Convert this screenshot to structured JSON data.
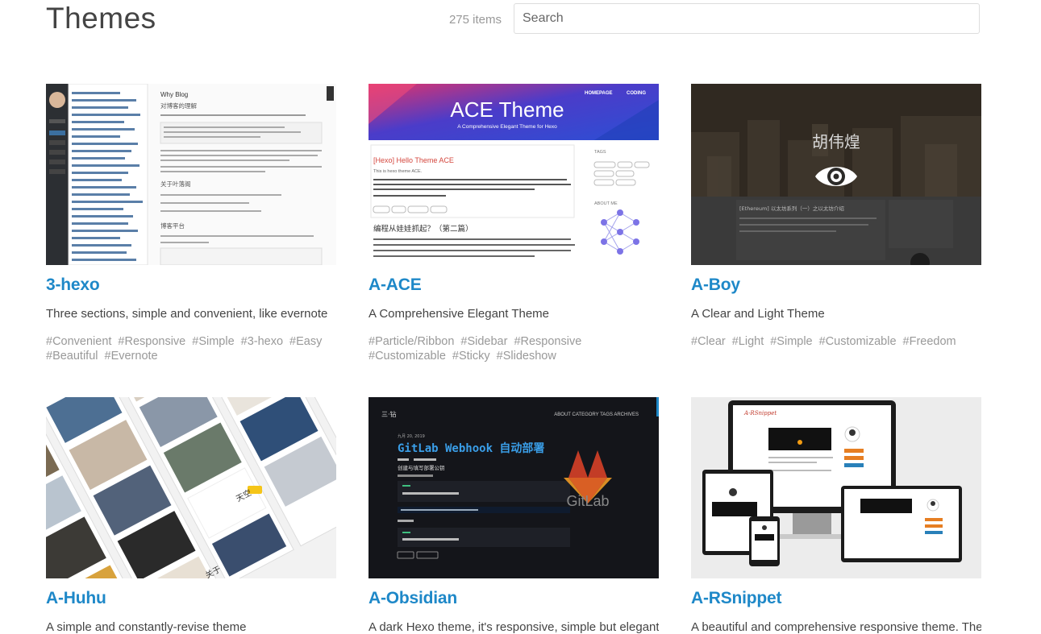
{
  "header": {
    "title": "Themes",
    "count": "275 items",
    "search_placeholder": "Search"
  },
  "cards": [
    {
      "name": "3-hexo",
      "description": "Three sections, simple and convenient, like evernote",
      "tags": [
        "#Convenient",
        "#Responsive",
        "#Simple",
        "#3-hexo",
        "#Easy",
        "#Beautiful",
        "#Evernote"
      ],
      "thumb": {
        "post_title": "Why Blog",
        "heading": "对博客的理解",
        "section1": "关于叶落阁",
        "section2": "博客平台"
      }
    },
    {
      "name": "A-ACE",
      "description": "A Comprehensive Elegant Theme",
      "tags": [
        "#Particle/Ribbon",
        "#Sidebar",
        "#Responsive",
        "#Customizable",
        "#Sticky",
        "#Slideshow"
      ],
      "thumb": {
        "nav1": "HOMEPAGE",
        "nav2": "CODING",
        "hero": "ACE Theme",
        "sub": "A Comprehensive Elegant Theme for Hexo",
        "post1": "[Hexo] Hello Theme ACE",
        "post1_line": "This is hexo theme ACE.",
        "post2": "编程从娃娃抓起？（第二篇）",
        "side1": "TAGS",
        "side2": "ABOUT ME"
      }
    },
    {
      "name": "A-Boy",
      "description": "A Clear and Light Theme",
      "tags": [
        "#Clear",
        "#Light",
        "#Simple",
        "#Customizable",
        "#Freedom"
      ],
      "thumb": {
        "overlay": "胡伟煌",
        "post": "[Ethereum] 以太坊系列（一）之以太坊介绍"
      }
    },
    {
      "name": "A-Huhu",
      "description": "A simple and constantly-revise theme",
      "tags": [],
      "thumb": {
        "label1": "天空",
        "label2": "关于"
      }
    },
    {
      "name": "A-Obsidian",
      "description": "A dark Hexo theme, it's responsive, simple but elegant",
      "tags": [],
      "thumb": {
        "brand": "三·钻",
        "nav": "ABOUT  CATEGORY  TAGS  ARCHIVES",
        "date": "九月 20, 2019",
        "title": "GitLab Webhook 自动部署",
        "subtitle": "创建与填写部署公钥",
        "logo": "GitLab"
      }
    },
    {
      "name": "A-RSnippet",
      "description": "A beautiful and comprehensive responsive theme. The",
      "tags": [],
      "thumb": {
        "logo": "A-RSnippet"
      }
    }
  ],
  "colors": {
    "link": "#1e88c8",
    "tag": "#999999",
    "title": "#444444"
  }
}
